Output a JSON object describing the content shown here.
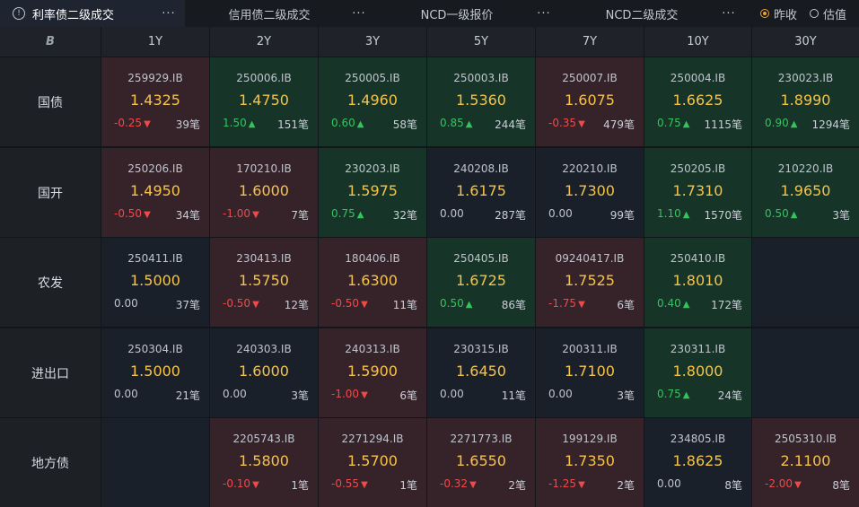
{
  "tabs": [
    {
      "label": "利率债二级成交",
      "active": true
    },
    {
      "label": "信用债二级成交",
      "active": false
    },
    {
      "label": "NCD一级报价",
      "active": false
    },
    {
      "label": "NCD二级成交",
      "active": false
    }
  ],
  "more_label": "···",
  "info_glyph": "!",
  "radios": [
    {
      "label": "昨收",
      "checked": true
    },
    {
      "label": "估值",
      "checked": false
    }
  ],
  "corner_logo": "B",
  "terms": [
    "1Y",
    "2Y",
    "3Y",
    "5Y",
    "7Y",
    "10Y",
    "30Y"
  ],
  "rows": [
    {
      "label": "国债",
      "cells": [
        {
          "code": "259929.IB",
          "price": "1.4325",
          "change": "-0.25",
          "dir": "down",
          "count": "39笔"
        },
        {
          "code": "250006.IB",
          "price": "1.4750",
          "change": "1.50",
          "dir": "up",
          "count": "151笔"
        },
        {
          "code": "250005.IB",
          "price": "1.4960",
          "change": "0.60",
          "dir": "up",
          "count": "58笔"
        },
        {
          "code": "250003.IB",
          "price": "1.5360",
          "change": "0.85",
          "dir": "up",
          "count": "244笔"
        },
        {
          "code": "250007.IB",
          "price": "1.6075",
          "change": "-0.35",
          "dir": "down",
          "count": "479笔"
        },
        {
          "code": "250004.IB",
          "price": "1.6625",
          "change": "0.75",
          "dir": "up",
          "count": "1115笔"
        },
        {
          "code": "230023.IB",
          "price": "1.8990",
          "change": "0.90",
          "dir": "up",
          "count": "1294笔"
        }
      ]
    },
    {
      "label": "国开",
      "cells": [
        {
          "code": "250206.IB",
          "price": "1.4950",
          "change": "-0.50",
          "dir": "down",
          "count": "34笔"
        },
        {
          "code": "170210.IB",
          "price": "1.6000",
          "change": "-1.00",
          "dir": "down",
          "count": "7笔"
        },
        {
          "code": "230203.IB",
          "price": "1.5975",
          "change": "0.75",
          "dir": "up",
          "count": "32笔"
        },
        {
          "code": "240208.IB",
          "price": "1.6175",
          "change": "0.00",
          "dir": "neu",
          "count": "287笔"
        },
        {
          "code": "220210.IB",
          "price": "1.7300",
          "change": "0.00",
          "dir": "neu",
          "count": "99笔"
        },
        {
          "code": "250205.IB",
          "price": "1.7310",
          "change": "1.10",
          "dir": "up",
          "count": "1570笔"
        },
        {
          "code": "210220.IB",
          "price": "1.9650",
          "change": "0.50",
          "dir": "up",
          "count": "3笔"
        }
      ]
    },
    {
      "label": "农发",
      "cells": [
        {
          "code": "250411.IB",
          "price": "1.5000",
          "change": "0.00",
          "dir": "neu",
          "count": "37笔"
        },
        {
          "code": "230413.IB",
          "price": "1.5750",
          "change": "-0.50",
          "dir": "down",
          "count": "12笔"
        },
        {
          "code": "180406.IB",
          "price": "1.6300",
          "change": "-0.50",
          "dir": "down",
          "count": "11笔"
        },
        {
          "code": "250405.IB",
          "price": "1.6725",
          "change": "0.50",
          "dir": "up",
          "count": "86笔"
        },
        {
          "code": "09240417.IB",
          "price": "1.7525",
          "change": "-1.75",
          "dir": "down",
          "count": "6笔"
        },
        {
          "code": "250410.IB",
          "price": "1.8010",
          "change": "0.40",
          "dir": "up",
          "count": "172笔"
        },
        null
      ]
    },
    {
      "label": "进出口",
      "cells": [
        {
          "code": "250304.IB",
          "price": "1.5000",
          "change": "0.00",
          "dir": "neu",
          "count": "21笔"
        },
        {
          "code": "240303.IB",
          "price": "1.6000",
          "change": "0.00",
          "dir": "neu",
          "count": "3笔"
        },
        {
          "code": "240313.IB",
          "price": "1.5900",
          "change": "-1.00",
          "dir": "down",
          "count": "6笔"
        },
        {
          "code": "230315.IB",
          "price": "1.6450",
          "change": "0.00",
          "dir": "neu",
          "count": "11笔"
        },
        {
          "code": "200311.IB",
          "price": "1.7100",
          "change": "0.00",
          "dir": "neu",
          "count": "3笔"
        },
        {
          "code": "230311.IB",
          "price": "1.8000",
          "change": "0.75",
          "dir": "up",
          "count": "24笔"
        },
        null
      ]
    },
    {
      "label": "地方债",
      "cells": [
        null,
        {
          "code": "2205743.IB",
          "price": "1.5800",
          "change": "-0.10",
          "dir": "down",
          "count": "1笔"
        },
        {
          "code": "2271294.IB",
          "price": "1.5700",
          "change": "-0.55",
          "dir": "down",
          "count": "1笔"
        },
        {
          "code": "2271773.IB",
          "price": "1.6550",
          "change": "-0.32",
          "dir": "down",
          "count": "2笔"
        },
        {
          "code": "199129.IB",
          "price": "1.7350",
          "change": "-1.25",
          "dir": "down",
          "count": "2笔"
        },
        {
          "code": "234805.IB",
          "price": "1.8625",
          "change": "0.00",
          "dir": "neu",
          "count": "8笔"
        },
        {
          "code": "2505310.IB",
          "price": "2.1100",
          "change": "-2.00",
          "dir": "down",
          "count": "8笔"
        }
      ]
    }
  ],
  "colors": {
    "up": "#35c35c",
    "down": "#ef4a4a",
    "price": "#f6c34a",
    "accent": "#f0a030"
  }
}
